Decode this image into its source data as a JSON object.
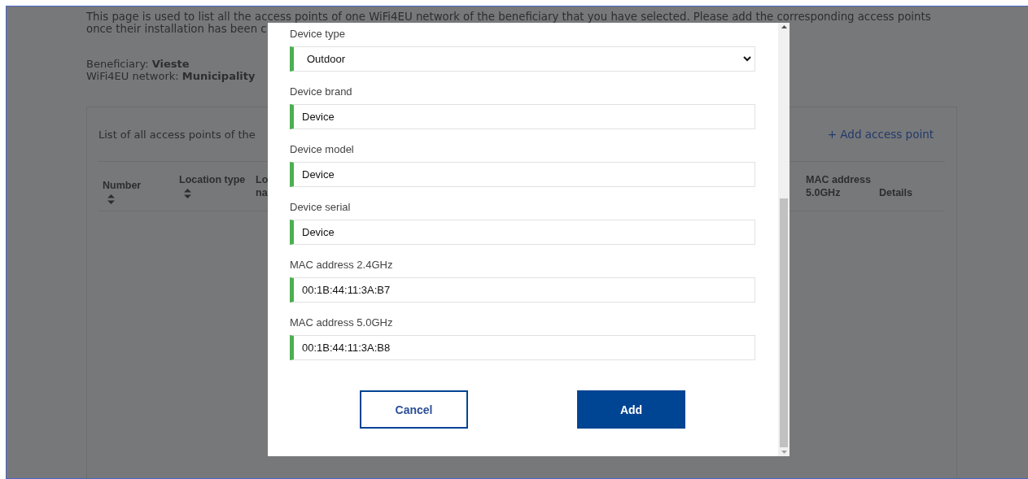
{
  "page": {
    "intro_line_1": "This page is used to list all the access points of one WiFi4EU network of the beneficiary that you have selected. Please add the corresponding access points",
    "intro_line_2": "once their installation has been c",
    "beneficiary": {
      "label": "Beneficiary:",
      "value": "Vieste"
    },
    "network": {
      "label": "WiFi4EU network:",
      "value": "Municipality"
    },
    "card": {
      "title": "List of all access points of the",
      "add_link": "+ Add access point",
      "columns": [
        {
          "label": "Number",
          "sortable": true
        },
        {
          "label": "Location type",
          "sortable": true
        },
        {
          "label": "Lo na",
          "sortable": false
        },
        {
          "label": "MAC address 5.0GHz",
          "sortable": false
        },
        {
          "label": "Details",
          "sortable": false
        }
      ]
    }
  },
  "dialog": {
    "fields": [
      {
        "kind": "select",
        "label": "Device type",
        "value": "Outdoor",
        "valid": true
      },
      {
        "kind": "text",
        "label": "Device brand",
        "value": "Device",
        "valid": true
      },
      {
        "kind": "text",
        "label": "Device model",
        "value": "Device",
        "valid": true
      },
      {
        "kind": "text",
        "label": "Device serial",
        "value": "Device",
        "valid": true
      },
      {
        "kind": "text",
        "label": "MAC address 2.4GHz",
        "value": "00:1B:44:11:3A:B7",
        "valid": true
      },
      {
        "kind": "text",
        "label": "MAC address 5.0GHz",
        "value": "00:1B:44:11:3A:B8",
        "valid": true
      }
    ],
    "buttons": [
      {
        "kind": "secondary",
        "label": "Cancel"
      },
      {
        "kind": "primary",
        "label": "Add"
      }
    ]
  }
}
